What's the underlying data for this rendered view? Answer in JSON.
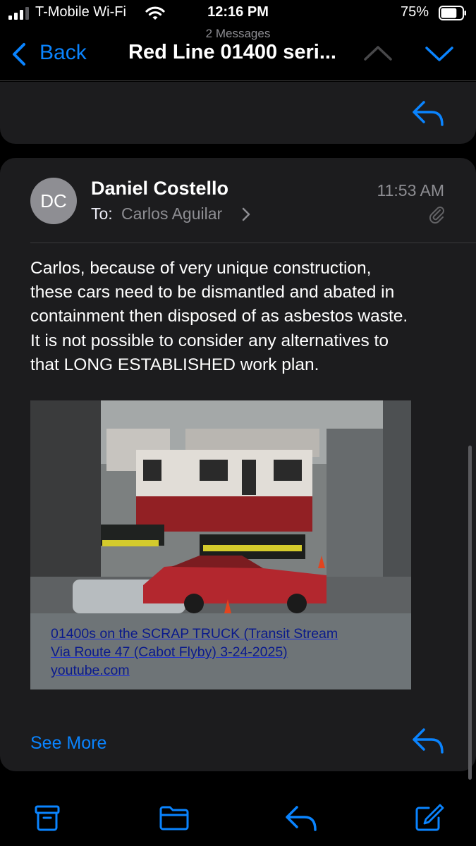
{
  "status_bar": {
    "carrier": "T-Mobile Wi-Fi",
    "time": "12:16 PM",
    "battery_percent": "75%",
    "battery_level": 0.75
  },
  "nav": {
    "message_count": "2 Messages",
    "back_label": "Back",
    "title": "Red Line 01400 seri..."
  },
  "message": {
    "avatar_initials": "DC",
    "sender": "Daniel Costello",
    "to_label": "To:",
    "recipient": "Carlos Aguilar",
    "time": "11:53 AM",
    "body_lines": [
      "Carlos, because of very unique construction,",
      "these cars need to be dismantled and abated in",
      "containment then disposed of as asbestos waste.",
      "It is not possible to consider any alternatives to",
      "that LONG ESTABLISHED work plan."
    ],
    "link_preview": {
      "title_lines": [
        "01400s on the SCRAP TRUCK (Transit Stream",
        "Via Route 47 (Cabot Flyby) 3-24-2025)"
      ],
      "domain": "youtube.com"
    },
    "see_more": "See More"
  },
  "colors": {
    "accent": "#0a84ff",
    "card": "#1c1c1e",
    "background": "#000000",
    "secondary_text": "#8e8e93",
    "link_text": "#0a1a8c"
  },
  "icons": {
    "back": "chevron-left-icon",
    "prev": "chevron-up-icon",
    "next": "chevron-down-icon",
    "reply": "reply-icon",
    "attachment": "paperclip-icon",
    "archive": "archive-icon",
    "folder": "folder-icon",
    "compose": "compose-icon"
  }
}
